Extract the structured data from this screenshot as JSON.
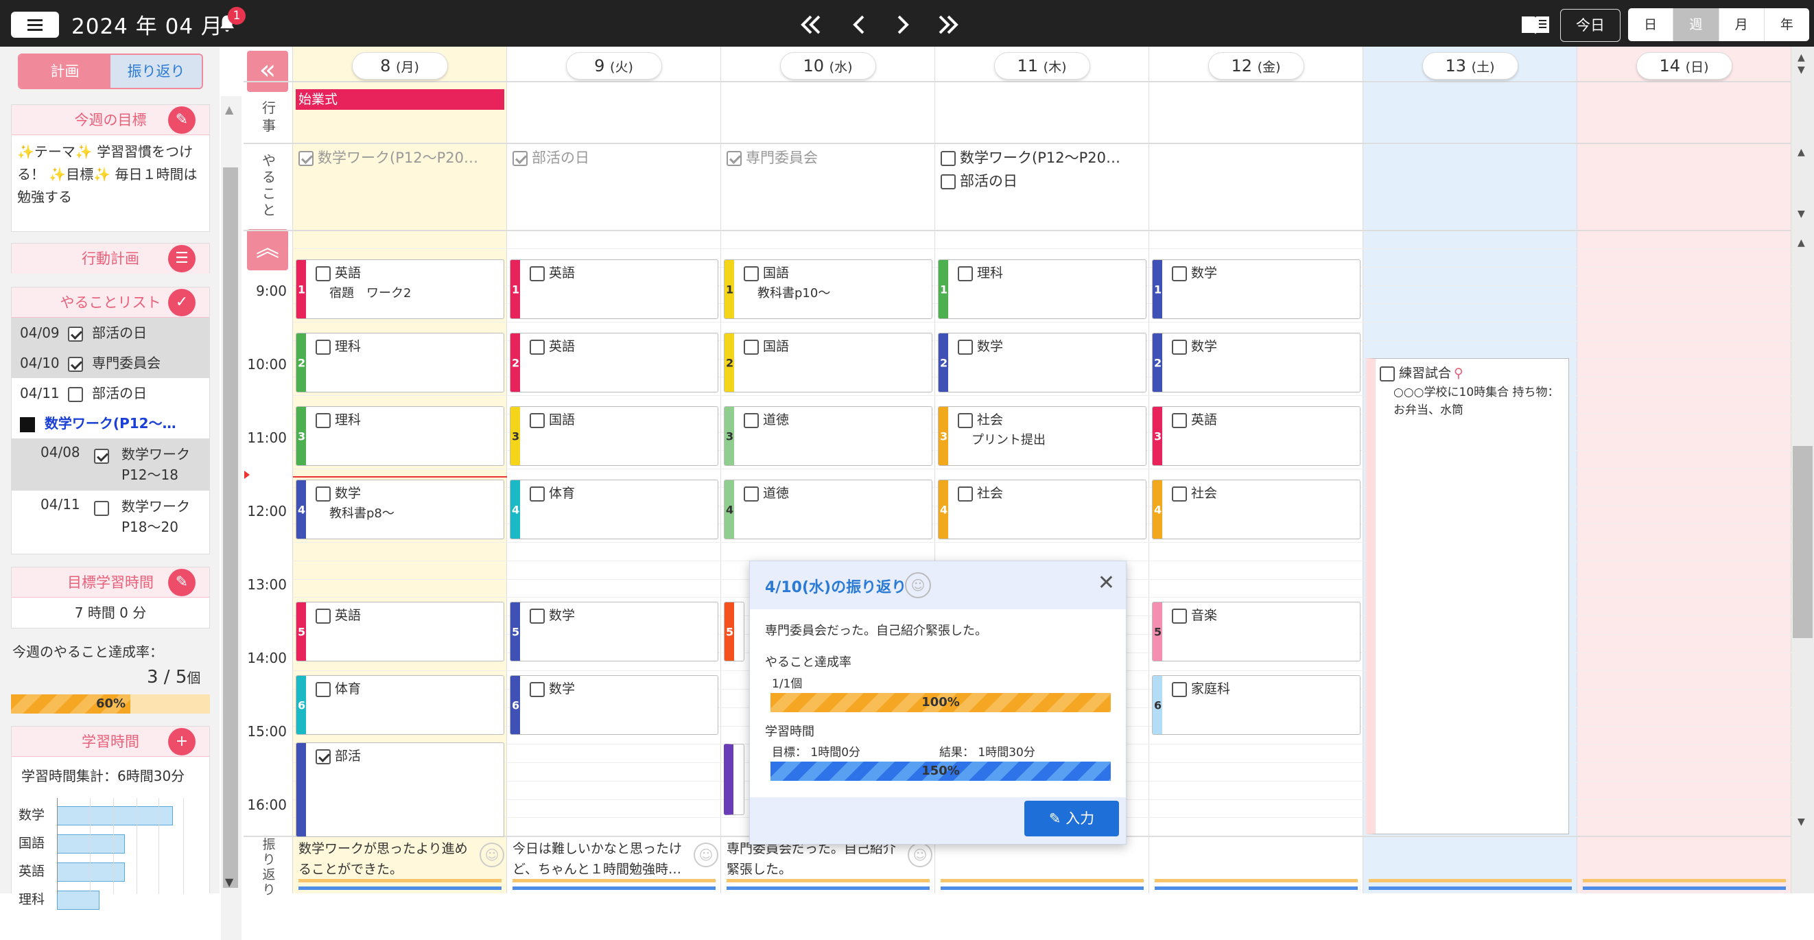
{
  "header": {
    "title": "2024 年 04 月",
    "notification_count": "1",
    "today_label": "今日",
    "views": [
      "日",
      "週",
      "月",
      "年"
    ],
    "active_view": "週"
  },
  "sidebar": {
    "tabs": {
      "plan": "計画",
      "review": "振り返り"
    },
    "weekly_goal": {
      "title": "今週の目標",
      "text": "✨テーマ✨ 学習習慣をつける！ ✨目標✨ 毎日１時間は勉強する"
    },
    "action_plan": {
      "title": "行動計画"
    },
    "todo_list": {
      "title": "やることリスト",
      "items": [
        {
          "date": "04/09",
          "label": "部活の日",
          "checked": true
        },
        {
          "date": "04/10",
          "label": "専門委員会",
          "checked": true
        },
        {
          "date": "04/11",
          "label": "部活の日",
          "checked": false
        }
      ],
      "group": {
        "title": "数学ワーク(P12〜…",
        "items": [
          {
            "date": "04/08",
            "label": "数学ワーク P12〜18",
            "checked": true
          },
          {
            "date": "04/11",
            "label": "数学ワーク P18〜20",
            "checked": false
          }
        ]
      }
    },
    "target_time": {
      "title": "目標学習時間",
      "value": "7 時間 0 分"
    },
    "achievement": {
      "label": "今週のやること達成率：",
      "value": "3 / 5",
      "unit": "個",
      "percent_label": "60%",
      "percent": 60
    },
    "study_time": {
      "title": "学習時間",
      "total_label": "学習時間集計：6時間30分",
      "subjects": [
        {
          "name": "数学",
          "fraction": 0.82
        },
        {
          "name": "国語",
          "fraction": 0.48
        },
        {
          "name": "英語",
          "fraction": 0.48
        },
        {
          "name": "理科",
          "fraction": 0.3
        }
      ]
    }
  },
  "grid": {
    "row_labels": {
      "events": "行事",
      "todo": "やること",
      "review": "振り返り"
    },
    "hours": [
      "9:00",
      "10:00",
      "11:00",
      "12:00",
      "13:00",
      "14:00",
      "15:00",
      "16:00"
    ],
    "days": [
      {
        "num": "8",
        "dow": "(月)"
      },
      {
        "num": "9",
        "dow": "(火)"
      },
      {
        "num": "10",
        "dow": "(水)"
      },
      {
        "num": "11",
        "dow": "(木)"
      },
      {
        "num": "12",
        "dow": "(金)"
      },
      {
        "num": "13",
        "dow": "(土)"
      },
      {
        "num": "14",
        "dow": "(日)"
      }
    ],
    "event_mon": "始業式",
    "todos": {
      "mon": "数学ワーク(P12〜P20…",
      "tue": "部活の日",
      "wed": "専門委員会",
      "thu1": "数学ワーク(P12〜P20…",
      "thu2": "部活の日"
    },
    "sat_event": {
      "title": "練習試合",
      "detail": "○○○学校に10時集合 持ち物：お弁当、水筒"
    }
  },
  "lessons": {
    "mon": [
      {
        "n": "1",
        "t": "英語",
        "s": "宿題　ワーク2"
      },
      {
        "n": "2",
        "t": "理科",
        "s": ""
      },
      {
        "n": "3",
        "t": "理科",
        "s": ""
      },
      {
        "n": "4",
        "t": "数学",
        "s": "教科書p8〜"
      },
      {
        "n": "5",
        "t": "英語",
        "s": ""
      },
      {
        "n": "6",
        "t": "体育",
        "s": ""
      },
      {
        "n": "",
        "t": "部活",
        "s": ""
      }
    ],
    "tue": [
      {
        "n": "1",
        "t": "英語",
        "s": ""
      },
      {
        "n": "2",
        "t": "英語",
        "s": ""
      },
      {
        "n": "3",
        "t": "国語",
        "s": ""
      },
      {
        "n": "4",
        "t": "体育",
        "s": ""
      },
      {
        "n": "5",
        "t": "数学",
        "s": ""
      },
      {
        "n": "6",
        "t": "数学",
        "s": ""
      }
    ],
    "wed": [
      {
        "n": "1",
        "t": "国語",
        "s": "教科書p10〜"
      },
      {
        "n": "2",
        "t": "国語",
        "s": ""
      },
      {
        "n": "3",
        "t": "道徳",
        "s": ""
      },
      {
        "n": "4",
        "t": "道徳",
        "s": ""
      },
      {
        "n": "5",
        "t": "",
        "s": ""
      }
    ],
    "thu": [
      {
        "n": "1",
        "t": "理科",
        "s": ""
      },
      {
        "n": "2",
        "t": "数学",
        "s": ""
      },
      {
        "n": "3",
        "t": "社会",
        "s": "プリント提出"
      },
      {
        "n": "4",
        "t": "社会",
        "s": ""
      }
    ],
    "fri": [
      {
        "n": "1",
        "t": "数学",
        "s": ""
      },
      {
        "n": "2",
        "t": "数学",
        "s": ""
      },
      {
        "n": "3",
        "t": "英語",
        "s": ""
      },
      {
        "n": "4",
        "t": "社会",
        "s": ""
      },
      {
        "n": "5",
        "t": "音楽",
        "s": ""
      },
      {
        "n": "6",
        "t": "家庭科",
        "s": ""
      }
    ]
  },
  "reviews": {
    "mon": "数学ワークが思ったより進めることができた。",
    "tue": "今日は難しいかなと思ったけど、ちゃんと１時間勉強時…",
    "wed": "専門委員会だった。自己紹介緊張した。"
  },
  "popup": {
    "title": "4/10(水)の振り返り",
    "comment": "専門委員会だった。自己紹介緊張した。",
    "todo_rate_label": "やること達成率",
    "todo_count": "1/1個",
    "todo_percent_label": "100%",
    "todo_percent": 100,
    "study_label": "学習時間",
    "target": "目標： 1時間0分",
    "result": "結果： 1時間30分",
    "study_percent_label": "150%",
    "study_percent": 100,
    "input_button": "入力"
  },
  "colors": {
    "pink": "#e8225a",
    "green": "#4caf50",
    "indigo": "#3f51b5",
    "yellow": "#f5d51a",
    "light_green": "#8fce8f",
    "cyan": "#1bb8c6",
    "orange": "#f2a81d",
    "deep_orange": "#f4511e",
    "purple": "#6a3db8",
    "light_pink": "#f48fb1",
    "light_blue": "#b3dcf7"
  }
}
